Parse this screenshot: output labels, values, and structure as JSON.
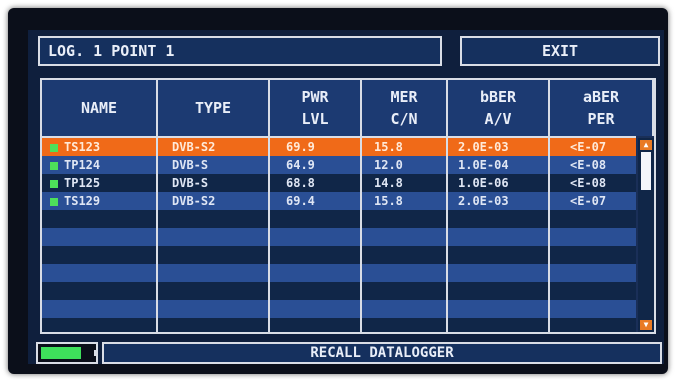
{
  "header": {
    "title": "LOG. 1   POINT 1",
    "exit_label": "EXIT"
  },
  "columns": [
    {
      "key": "name",
      "line1": "NAME",
      "line2": ""
    },
    {
      "key": "type",
      "line1": "TYPE",
      "line2": ""
    },
    {
      "key": "pwr",
      "line1": "PWR",
      "line2": "LVL"
    },
    {
      "key": "mer",
      "line1": "MER",
      "line2": "C/N"
    },
    {
      "key": "bber",
      "line1": "bBER",
      "line2": "A/V"
    },
    {
      "key": "aber",
      "line1": "aBER",
      "line2": "PER"
    }
  ],
  "rows": [
    {
      "name": "TS123",
      "type": "DVB-S2",
      "pwr": "69.9",
      "mer": "15.8",
      "bber": "2.0E-03",
      "aber": "<E-07",
      "selected": true
    },
    {
      "name": "TP124",
      "type": "DVB-S",
      "pwr": "64.9",
      "mer": "12.0",
      "bber": "1.0E-04",
      "aber": "<E-08",
      "selected": false
    },
    {
      "name": "TP125",
      "type": "DVB-S",
      "pwr": "68.8",
      "mer": "14.8",
      "bber": "1.0E-06",
      "aber": "<E-08",
      "selected": false
    },
    {
      "name": "TS129",
      "type": "DVB-S2",
      "pwr": "69.4",
      "mer": "15.8",
      "bber": "2.0E-03",
      "aber": "<E-07",
      "selected": false
    }
  ],
  "empty_rows": 7,
  "status": {
    "label": "RECALL DATALOGGER",
    "battery_level": 0.8
  },
  "colors": {
    "selected_row": "#f06a18",
    "led": "#4de05a",
    "battery": "#3ee05b"
  },
  "icons": {
    "row_indicator": "green-led-icon",
    "battery": "battery-icon",
    "scroll_up": "arrow-up-icon",
    "scroll_down": "arrow-down-icon"
  }
}
